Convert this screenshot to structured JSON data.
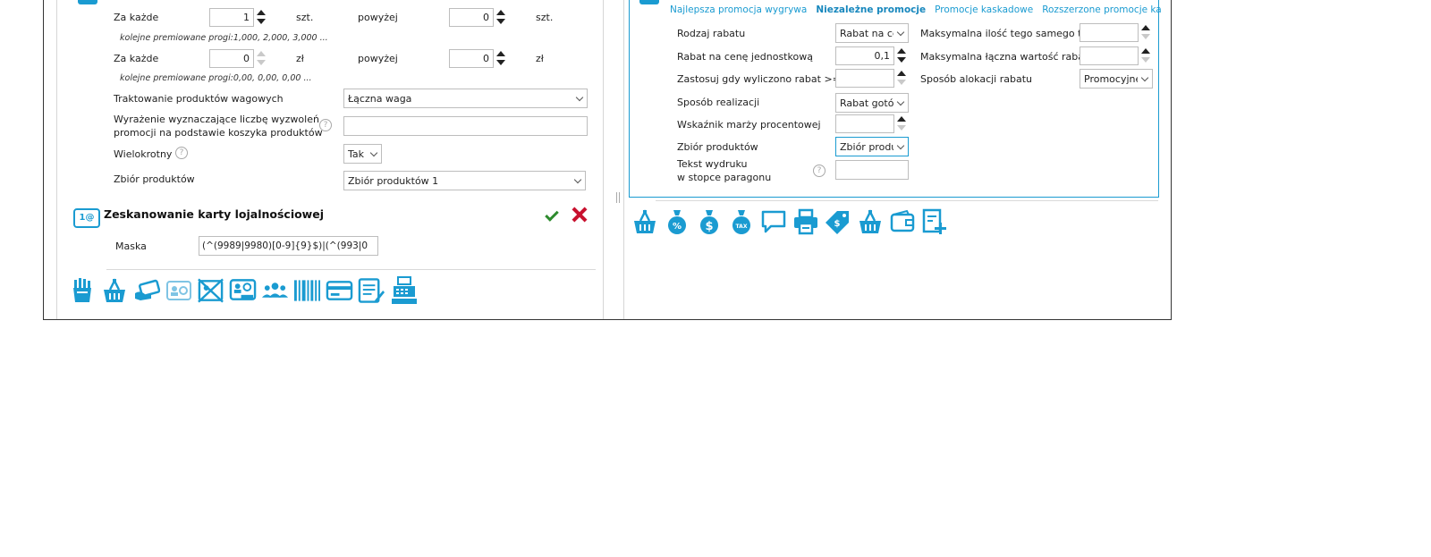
{
  "left": {
    "row1": {
      "label": "Za każde",
      "value": "1",
      "unit": "szt.",
      "above_label": "powyżej",
      "above_value": "0",
      "above_unit": "szt.",
      "hint": "kolejne premiowane progi:1,000, 2,000, 3,000 ..."
    },
    "row2": {
      "label": "Za każde",
      "value": "0",
      "unit": "zł",
      "above_label": "powyżej",
      "above_value": "0",
      "above_unit": "zł",
      "hint": "kolejne premiowane progi:0,00, 0,00, 0,00 ..."
    },
    "weight_label": "Traktowanie produktów wagowych",
    "weight_value": "Łączna waga",
    "expr_label_1": "Wyrażenie wyznaczające liczbę wyzwoleń",
    "expr_label_2": "promocji na podstawie koszyka produktów",
    "multi_label": "Wielokrotny",
    "multi_value": "Tak",
    "set_label": "Zbiór produktów",
    "set_value": "Zbiór produktów 1",
    "loyalty": {
      "title": "Zeskanowanie karty lojalnościowej",
      "badge": "1@",
      "mask_label": "Maska",
      "mask_value": "(^(9989|9980)[0-9]{9}$)|(^(993|0"
    }
  },
  "right": {
    "tabs": [
      "Najlepsza promocja wygrywa",
      "Niezależne promocje",
      "Promocje kaskadowe",
      "Rozszerzone promocje ka"
    ],
    "active_tab": "Niezależne promocje",
    "fields": {
      "rodzaj_label": "Rodzaj rabatu",
      "rodzaj_value": "Rabat na ce",
      "cena_label": "Rabat na cenę jednostkową",
      "cena_value": "0,1",
      "zastosuj_label": "Zastosuj gdy wyliczono rabat >=",
      "zastosuj_value": "",
      "sposob_label": "Sposób realizacji",
      "sposob_value": "Rabat gotó",
      "marza_label": "Wskaźnik marży procentowej",
      "marza_value": "",
      "zbior_label": "Zbiór produktów",
      "zbior_value": "Zbiór produ",
      "tekst_label_1": "Tekst wydruku",
      "tekst_label_2": "w stopce paragonu",
      "max_qty_label": "Maksymalna ilość tego samego to",
      "max_val_label": "Maksymalna łączna wartość rabat",
      "alloc_label": "Sposób alokacji rabatu",
      "alloc_value": "Promocyjne"
    }
  },
  "icons": {
    "left_bar": [
      "hand-icon",
      "basket-icon",
      "card-hand-icon",
      "loyalty-card-icon",
      "no-card-icon",
      "status-card-icon",
      "group-icon",
      "barcode-icon",
      "credit-card-icon",
      "edit-list-icon",
      "cash-register-icon"
    ],
    "right_bar": [
      "basket-icon",
      "percent-bag-icon",
      "dollar-bag-icon",
      "tax-bag-icon",
      "message-icon",
      "printer-icon",
      "price-tag-icon",
      "basket-plus-icon",
      "wallet-icon",
      "add-document-icon"
    ]
  },
  "colors": {
    "accent": "#1a9bd1",
    "confirm": "#2e8b2e",
    "cancel": "#c8102e"
  }
}
